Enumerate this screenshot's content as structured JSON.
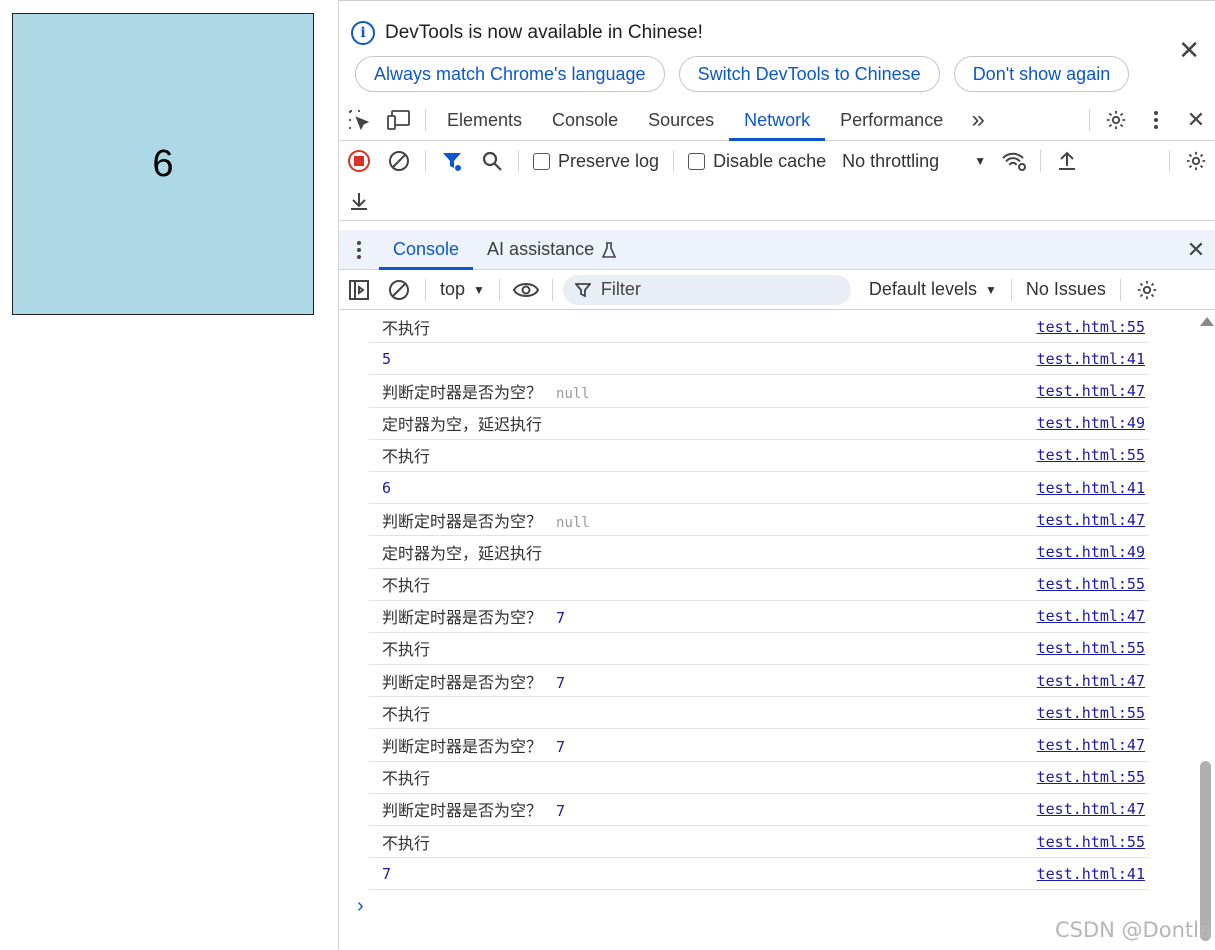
{
  "page": {
    "box_number": "6"
  },
  "infobar": {
    "message": "DevTools is now available in Chinese!",
    "btn_match": "Always match Chrome's language",
    "btn_switch": "Switch DevTools to Chinese",
    "btn_dont_show": "Don't show again",
    "close": "✕"
  },
  "tabs": {
    "elements": "Elements",
    "console": "Console",
    "sources": "Sources",
    "network": "Network",
    "performance": "Performance",
    "more": "»"
  },
  "network_toolbar": {
    "preserve_log": "Preserve log",
    "disable_cache": "Disable cache",
    "throttling": "No throttling"
  },
  "drawer": {
    "console_tab": "Console",
    "ai_tab": "AI assistance"
  },
  "console_toolbar": {
    "context": "top",
    "filter_placeholder": "Filter",
    "levels": "Default levels",
    "issues": "No Issues"
  },
  "log_rows": [
    {
      "text": "不执行",
      "extra": "",
      "source": "test.html:55"
    },
    {
      "text": "",
      "extra": "5",
      "source": "test.html:41"
    },
    {
      "text": "判断定时器是否为空？",
      "extra": "null",
      "source": "test.html:47"
    },
    {
      "text": "定时器为空，延迟执行",
      "extra": "",
      "source": "test.html:49"
    },
    {
      "text": "不执行",
      "extra": "",
      "source": "test.html:55"
    },
    {
      "text": "",
      "extra": "6",
      "source": "test.html:41"
    },
    {
      "text": "判断定时器是否为空？",
      "extra": "null",
      "source": "test.html:47"
    },
    {
      "text": "定时器为空，延迟执行",
      "extra": "",
      "source": "test.html:49"
    },
    {
      "text": "不执行",
      "extra": "",
      "source": "test.html:55"
    },
    {
      "text": "判断定时器是否为空？",
      "extra": "7",
      "source": "test.html:47"
    },
    {
      "text": "不执行",
      "extra": "",
      "source": "test.html:55"
    },
    {
      "text": "判断定时器是否为空？",
      "extra": "7",
      "source": "test.html:47"
    },
    {
      "text": "不执行",
      "extra": "",
      "source": "test.html:55"
    },
    {
      "text": "判断定时器是否为空？",
      "extra": "7",
      "source": "test.html:47"
    },
    {
      "text": "不执行",
      "extra": "",
      "source": "test.html:55"
    },
    {
      "text": "判断定时器是否为空？",
      "extra": "7",
      "source": "test.html:47"
    },
    {
      "text": "不执行",
      "extra": "",
      "source": "test.html:55"
    },
    {
      "text": "",
      "extra": "7",
      "source": "test.html:41"
    }
  ],
  "watermark": "CSDN @Dontla",
  "colors": {
    "accent": "#0b57d0",
    "box": "#add8e6",
    "record": "#d93025",
    "log_number": "#1a1aa6"
  }
}
